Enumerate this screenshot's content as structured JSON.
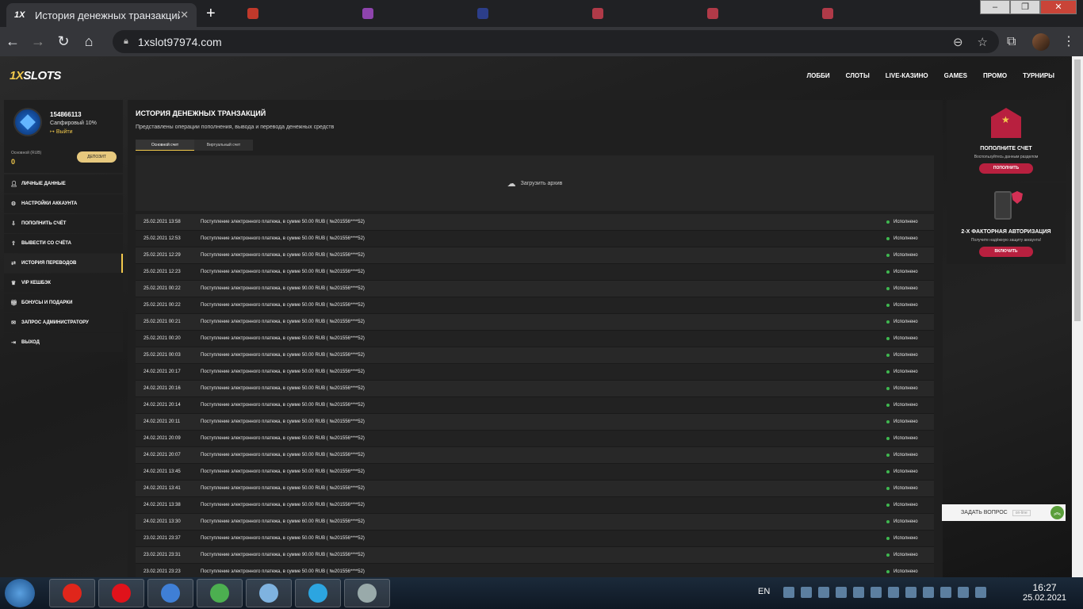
{
  "browser": {
    "tab_title": "История денежных транзакций",
    "favicon_text": "1X",
    "url": "1xslot97974.com",
    "background_tabs": [
      {
        "color": "#c0392b"
      },
      {
        "color": "#8e44ad"
      },
      {
        "color": "#2c3e8a"
      },
      {
        "color": "#b03a48"
      },
      {
        "color": "#b03a48"
      },
      {
        "color": "#b03a48"
      }
    ]
  },
  "site": {
    "logo_prefix": "1X",
    "logo_rest": "SLOTS",
    "nav": [
      "ЛОББИ",
      "СЛОТЫ",
      "LIVE-КАЗИНО",
      "GAMES",
      "ПРОМО",
      "ТУРНИРЫ"
    ]
  },
  "profile": {
    "id": "154866113",
    "rank": "Сапфировый 10%",
    "logout": "Выйти",
    "account_label": "Основной (RUB)",
    "balance": "0",
    "deposit_label": "ДЕПОЗИТ"
  },
  "sidebar": {
    "items": [
      {
        "label": "ЛИЧНЫЕ ДАННЫЕ",
        "icon": "user-icon"
      },
      {
        "label": "НАСТРОЙКИ АККАУНТА",
        "icon": "settings-icon"
      },
      {
        "label": "ПОПОЛНИТЬ СЧЁТ",
        "icon": "deposit-icon"
      },
      {
        "label": "ВЫВЕСТИ СО СЧЁТА",
        "icon": "withdraw-icon"
      },
      {
        "label": "ИСТОРИЯ ПЕРЕВОДОВ",
        "icon": "transfer-icon",
        "active": true
      },
      {
        "label": "VIP КЕШБЭК",
        "icon": "crown-icon"
      },
      {
        "label": "БОНУСЫ И ПОДАРКИ",
        "icon": "gift-icon"
      },
      {
        "label": "ЗАПРОС АДМИНИСТРАТОРУ",
        "icon": "mail-icon"
      },
      {
        "label": "ВЫХОД",
        "icon": "exit-icon"
      }
    ]
  },
  "main": {
    "title": "ИСТОРИЯ ДЕНЕЖНЫХ ТРАНЗАКЦИЙ",
    "subtitle": "Представлены операции пополнения, вывода и перевода денежных средств",
    "tabs": [
      "Основной счет",
      "Виртуальный счет"
    ],
    "archive_label": "Загрузить архив",
    "transactions": [
      {
        "date": "25.02.2021 13:58",
        "desc": "Поступление электронного платежа, в сумме 50.00 RUB ( №201556****52)",
        "status": "Исполнено"
      },
      {
        "date": "25.02.2021 12:53",
        "desc": "Поступление электронного платежа, в сумме 50.00 RUB ( №201556****52)",
        "status": "Исполнено"
      },
      {
        "date": "25.02.2021 12:29",
        "desc": "Поступление электронного платежа, в сумме 50.00 RUB ( №201556****52)",
        "status": "Исполнено"
      },
      {
        "date": "25.02.2021 12:23",
        "desc": "Поступление электронного платежа, в сумме 50.00 RUB ( №201556****52)",
        "status": "Исполнено"
      },
      {
        "date": "25.02.2021 00:22",
        "desc": "Поступление электронного платежа, в сумме 90.00 RUB ( №201556****52)",
        "status": "Исполнено"
      },
      {
        "date": "25.02.2021 00:22",
        "desc": "Поступление электронного платежа, в сумме 50.00 RUB ( №201556****52)",
        "status": "Исполнено"
      },
      {
        "date": "25.02.2021 00:21",
        "desc": "Поступление электронного платежа, в сумме 50.00 RUB ( №201556****52)",
        "status": "Исполнено"
      },
      {
        "date": "25.02.2021 00:20",
        "desc": "Поступление электронного платежа, в сумме 50.00 RUB ( №201556****52)",
        "status": "Исполнено"
      },
      {
        "date": "25.02.2021 00:03",
        "desc": "Поступление электронного платежа, в сумме 50.00 RUB ( №201556****52)",
        "status": "Исполнено"
      },
      {
        "date": "24.02.2021 20:17",
        "desc": "Поступление электронного платежа, в сумме 50.00 RUB ( №201556****52)",
        "status": "Исполнено"
      },
      {
        "date": "24.02.2021 20:16",
        "desc": "Поступление электронного платежа, в сумме 50.00 RUB ( №201556****52)",
        "status": "Исполнено"
      },
      {
        "date": "24.02.2021 20:14",
        "desc": "Поступление электронного платежа, в сумме 50.00 RUB ( №201556****52)",
        "status": "Исполнено"
      },
      {
        "date": "24.02.2021 20:11",
        "desc": "Поступление электронного платежа, в сумме 50.00 RUB ( №201556****52)",
        "status": "Исполнено"
      },
      {
        "date": "24.02.2021 20:09",
        "desc": "Поступление электронного платежа, в сумме 50.00 RUB ( №201556****52)",
        "status": "Исполнено"
      },
      {
        "date": "24.02.2021 20:07",
        "desc": "Поступление электронного платежа, в сумме 50.00 RUB ( №201556****52)",
        "status": "Исполнено"
      },
      {
        "date": "24.02.2021 13:45",
        "desc": "Поступление электронного платежа, в сумме 50.00 RUB ( №201556****52)",
        "status": "Исполнено"
      },
      {
        "date": "24.02.2021 13:41",
        "desc": "Поступление электронного платежа, в сумме 50.00 RUB ( №201556****52)",
        "status": "Исполнено"
      },
      {
        "date": "24.02.2021 13:38",
        "desc": "Поступление электронного платежа, в сумме 50.00 RUB ( №201556****52)",
        "status": "Исполнено"
      },
      {
        "date": "24.02.2021 13:30",
        "desc": "Поступление электронного платежа, в сумме 60.00 RUB ( №201556****52)",
        "status": "Исполнено"
      },
      {
        "date": "23.02.2021 23:37",
        "desc": "Поступление электронного платежа, в сумме 50.00 RUB ( №201556****52)",
        "status": "Исполнено"
      },
      {
        "date": "23.02.2021 23:31",
        "desc": "Поступление электронного платежа, в сумме 90.00 RUB ( №201556****52)",
        "status": "Исполнено"
      },
      {
        "date": "23.02.2021 23:23",
        "desc": "Поступление электронного платежа, в сумме 50.00 RUB ( №201556****52)",
        "status": "Исполнено"
      }
    ]
  },
  "widgets": {
    "deposit": {
      "title": "ПОПОЛНИТЕ СЧЕТ",
      "subtitle": "Воспользуйтесь данным разделом",
      "button": "ПОПОЛНИТЬ"
    },
    "twofa": {
      "title": "2-Х ФАКТОРНАЯ АВТОРИЗАЦИЯ",
      "subtitle": "Получите надёжную защиту аккаунта!",
      "button": "ВКЛЮЧИТЬ"
    }
  },
  "support": {
    "label": "ЗАДАТЬ ВОПРОС",
    "status": "on-line"
  },
  "taskbar": {
    "lang": "EN",
    "time": "16:27",
    "date": "25.02.2021",
    "apps": [
      {
        "name": "yandex-icon",
        "color": "#e0261b"
      },
      {
        "name": "opera-icon",
        "color": "#e0121b"
      },
      {
        "name": "chrome-beta-icon",
        "color": "#3f7fd6"
      },
      {
        "name": "chrome-icon",
        "color": "#4caf50"
      },
      {
        "name": "notepad-icon",
        "color": "#7fb3e0"
      },
      {
        "name": "telegram-icon",
        "color": "#2ca5e0"
      },
      {
        "name": "speaker-icon",
        "color": "#9aa"
      }
    ]
  }
}
